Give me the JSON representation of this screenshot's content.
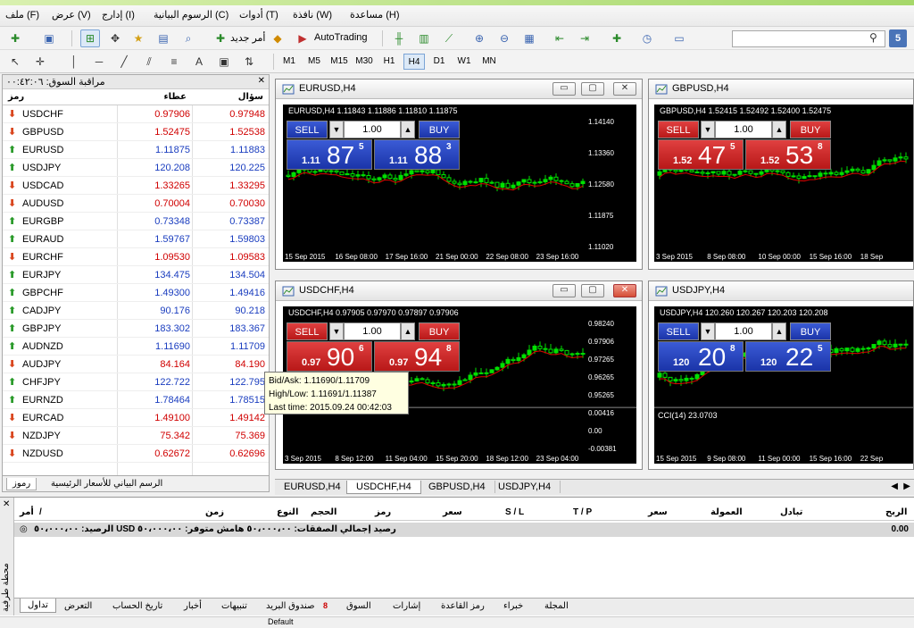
{
  "menu": {
    "file": "ملف (F)",
    "view": "عرض (V)",
    "insert": "إدارج (I)",
    "charts": "الرسوم البيانية (C)",
    "tools": "أدوات (T)",
    "window": "نافذة (W)",
    "help": "مساعدة (H)"
  },
  "toolbar": {
    "new_order": "أمر جديد",
    "autotrading": "AutoTrading",
    "timeframes": [
      "M1",
      "M5",
      "M15",
      "M30",
      "H1",
      "H4",
      "D1",
      "W1",
      "MN"
    ],
    "active_timeframe": "H4",
    "notifications": "5"
  },
  "market_watch": {
    "title": "مراقبة السوق: ٠٠:٤٢:٠٦",
    "col_symbol": "رمز",
    "col_bid": "عطاء",
    "col_ask": "سؤال",
    "rows": [
      {
        "symbol": "USDCHF",
        "bid": "0.97906",
        "ask": "0.97948",
        "dir": "down"
      },
      {
        "symbol": "GBPUSD",
        "bid": "1.52475",
        "ask": "1.52538",
        "dir": "down"
      },
      {
        "symbol": "EURUSD",
        "bid": "1.11875",
        "ask": "1.11883",
        "dir": "up"
      },
      {
        "symbol": "USDJPY",
        "bid": "120.208",
        "ask": "120.225",
        "dir": "up"
      },
      {
        "symbol": "USDCAD",
        "bid": "1.33265",
        "ask": "1.33295",
        "dir": "down"
      },
      {
        "symbol": "AUDUSD",
        "bid": "0.70004",
        "ask": "0.70030",
        "dir": "down"
      },
      {
        "symbol": "EURGBP",
        "bid": "0.73348",
        "ask": "0.73387",
        "dir": "up"
      },
      {
        "symbol": "EURAUD",
        "bid": "1.59767",
        "ask": "1.59803",
        "dir": "up"
      },
      {
        "symbol": "EURCHF",
        "bid": "1.09530",
        "ask": "1.09583",
        "dir": "down"
      },
      {
        "symbol": "EURJPY",
        "bid": "134.475",
        "ask": "134.504",
        "dir": "up"
      },
      {
        "symbol": "GBPCHF",
        "bid": "1.49300",
        "ask": "1.49416",
        "dir": "up"
      },
      {
        "symbol": "CADJPY",
        "bid": "90.176",
        "ask": "90.218",
        "dir": "up"
      },
      {
        "symbol": "GBPJPY",
        "bid": "183.302",
        "ask": "183.367",
        "dir": "up"
      },
      {
        "symbol": "AUDNZD",
        "bid": "1.11690",
        "ask": "1.11709",
        "dir": "up"
      },
      {
        "symbol": "AUDJPY",
        "bid": "84.164",
        "ask": "84.190",
        "dir": "down"
      },
      {
        "symbol": "CHFJPY",
        "bid": "122.722",
        "ask": "122.795",
        "dir": "up"
      },
      {
        "symbol": "EURNZD",
        "bid": "1.78464",
        "ask": "1.78515",
        "dir": "up"
      },
      {
        "symbol": "EURCAD",
        "bid": "1.49100",
        "ask": "1.49142",
        "dir": "down"
      },
      {
        "symbol": "NZDJPY",
        "bid": "75.342",
        "ask": "75.369",
        "dir": "down"
      },
      {
        "symbol": "NZDUSD",
        "bid": "0.62672",
        "ask": "0.62696",
        "dir": "down"
      }
    ],
    "tab_symbols": "رموز",
    "tab_chart": "الرسم البياني للأسعار الرئيسية"
  },
  "charts": [
    {
      "title": "EURUSD,H4",
      "info": "EURUSD,H4  1.11843 1.11886 1.11810 1.11875",
      "lot": "1.00",
      "sell": "SELL",
      "buy": "BUY",
      "sell_small": "1.11",
      "sell_big": "87",
      "sell_sup": "5",
      "buy_small": "1.11",
      "buy_big": "88",
      "buy_sup": "3",
      "panel_color": "blue",
      "price_labels": [
        "1.14140",
        "1.13360",
        "1.12580",
        "1.11875",
        "1.11020"
      ],
      "time_labels": [
        "15 Sep 2015",
        "16 Sep 08:00",
        "17 Sep 16:00",
        "21 Sep 00:00",
        "22 Sep 08:00",
        "23 Sep 16:00"
      ]
    },
    {
      "title": "GBPUSD,H4",
      "info": "GBPUSD,H4  1.52415 1.52492 1.52400 1.52475",
      "lot": "1.00",
      "sell": "SELL",
      "buy": "BUY",
      "sell_small": "1.52",
      "sell_big": "47",
      "sell_sup": "5",
      "buy_small": "1.52",
      "buy_big": "53",
      "buy_sup": "8",
      "panel_color": "red",
      "time_labels": [
        "3 Sep 2015",
        "8 Sep 08:00",
        "10 Sep 00:00",
        "15 Sep 16:00",
        "18 Sep"
      ]
    },
    {
      "title": "USDCHF,H4",
      "info": "USDCHF,H4  0.97905 0.97970 0.97897 0.97906",
      "lot": "1.00",
      "sell": "SELL",
      "buy": "BUY",
      "sell_small": "0.97",
      "sell_big": "90",
      "sell_sup": "6",
      "buy_small": "0.97",
      "buy_big": "94",
      "buy_sup": "8",
      "panel_color": "red",
      "price_labels": [
        "0.98240",
        "0.97906",
        "0.97265",
        "0.96265",
        "0.95265",
        "0.00416",
        "0.00",
        "-0.00381"
      ],
      "time_labels": [
        "3 Sep 2015",
        "8 Sep 12:00",
        "11 Sep 04:00",
        "15 Sep 20:00",
        "18 Sep 12:00",
        "23 Sep 04:00"
      ]
    },
    {
      "title": "USDJPY,H4",
      "info": "USDJPY,H4  120.260 120.267 120.203 120.208",
      "indicator": "CCI(14) 23.0703",
      "lot": "1.00",
      "sell": "SELL",
      "buy": "BUY",
      "sell_small": "120",
      "sell_big": "20",
      "sell_sup": "8",
      "buy_small": "120",
      "buy_big": "22",
      "buy_sup": "5",
      "panel_color": "blue",
      "time_labels": [
        "15 Sep 2015",
        "9 Sep 08:00",
        "11 Sep 00:00",
        "15 Sep 16:00",
        "22 Sep"
      ]
    }
  ],
  "chart_tabs": [
    "EURUSD,H4",
    "USDCHF,H4",
    "GBPUSD,H4",
    "USDJPY,H4"
  ],
  "active_chart_tab": "USDCHF,H4",
  "tooltip": {
    "line1": "Bid/Ask:   1.11690/1.11709",
    "line2": "High/Low: 1.11691/1.11387",
    "line3": "Last time: 2015.09.24 00:42:03"
  },
  "terminal": {
    "side_label": "محطة طرفية",
    "columns": {
      "order": "أمر",
      "time": "زمن",
      "type": "النوع",
      "volume": "الحجم",
      "symbol": "رمز",
      "price": "سعر",
      "sl": "S / L",
      "tp": "T / P",
      "price2": "سعر",
      "commission": "العمولة",
      "swap": "تبادل",
      "profit": "الربح"
    },
    "balance_row": "رصيد إجمالي الصفقات: ٥٠،٠٠٠،٠٠  هامش متوفر: ٥٠،٠٠٠،٠٠  USD الرصيد: ٥٠،٠٠٠،٠٠",
    "profit_value": "0.00",
    "tabs": [
      "تداول",
      "التعرض",
      "تاريخ الحساب",
      "أخبار",
      "تنبيهات",
      "صندوق البريد",
      "السوق",
      "إشارات",
      "رمز القاعدة",
      "خبراء",
      "المجلة"
    ],
    "mailbox_count": "8"
  },
  "status_bar": {
    "left": "",
    "profile": "Default"
  }
}
